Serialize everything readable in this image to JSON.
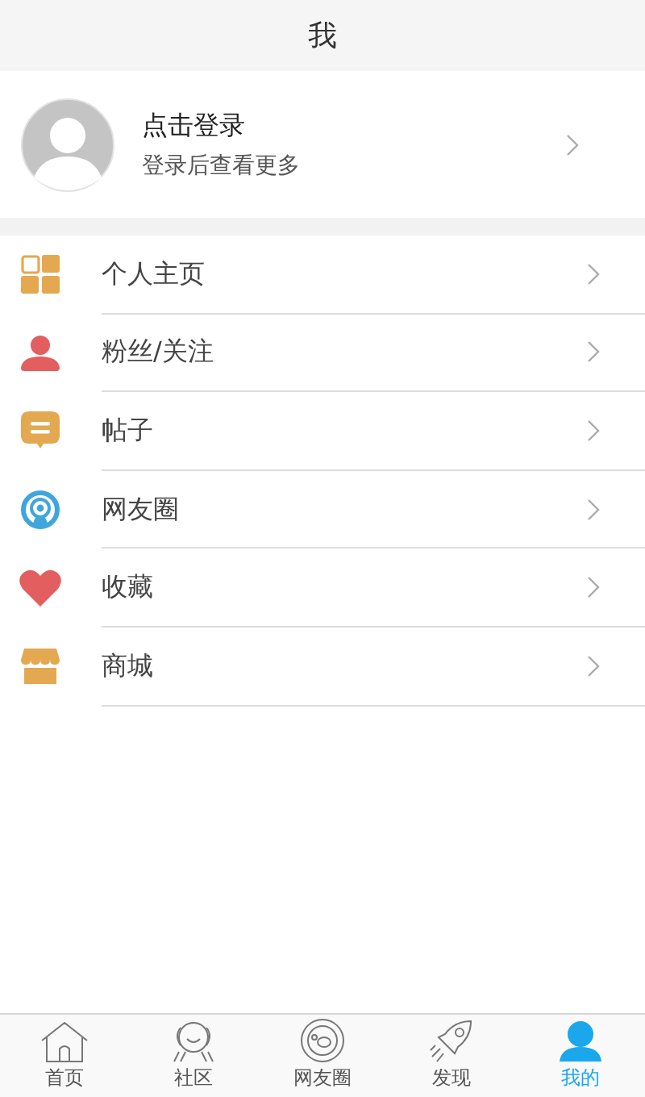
{
  "header": {
    "title": "我"
  },
  "profile": {
    "title": "点击登录",
    "subtitle": "登录后查看更多"
  },
  "menu": [
    {
      "label": "个人主页",
      "kind": "grid"
    },
    {
      "label": "粉丝/关注",
      "kind": "person"
    },
    {
      "label": "帖子",
      "kind": "chat"
    },
    {
      "label": "网友圈",
      "kind": "signal"
    },
    {
      "label": "收藏",
      "kind": "heart"
    },
    {
      "label": "商城",
      "kind": "store"
    }
  ],
  "tab_bar": [
    {
      "label": "首页",
      "kind": "home",
      "selected": false
    },
    {
      "label": "社区",
      "kind": "community",
      "selected": false
    },
    {
      "label": "网友圈",
      "kind": "planet",
      "selected": false
    },
    {
      "label": "发现",
      "kind": "rocket",
      "selected": false
    },
    {
      "label": "我的",
      "kind": "person",
      "selected": true
    }
  ]
}
